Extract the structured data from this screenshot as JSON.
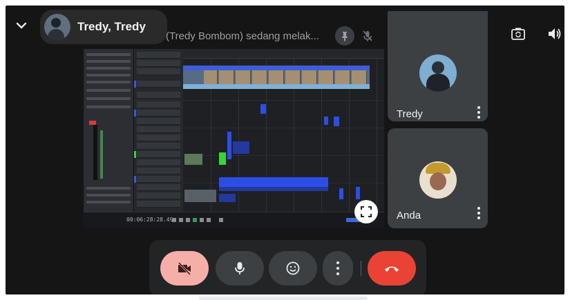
{
  "presenter": {
    "chip_name": "Tredy, Tredy",
    "status_text": "(Tredy Bombom) sedang melak..."
  },
  "icons": {
    "collapse": "chevron-down-icon",
    "pin": "pin-icon",
    "mic_off": "mic-off-icon",
    "switch_camera": "switch-camera-icon",
    "speaker": "speaker-icon",
    "fullscreen": "fullscreen-icon",
    "video_off": "video-off-icon",
    "mic": "mic-icon",
    "emoji": "emoji-icon",
    "more": "more-vert-icon",
    "end_call": "end-call-icon"
  },
  "tiles": [
    {
      "name": "Tredy"
    },
    {
      "name": "Anda"
    }
  ],
  "colors": {
    "camera_off_button": "#f6aea9",
    "end_call_button": "#ea4335",
    "tile_background": "#3c4043",
    "screen_background": "#151515"
  }
}
